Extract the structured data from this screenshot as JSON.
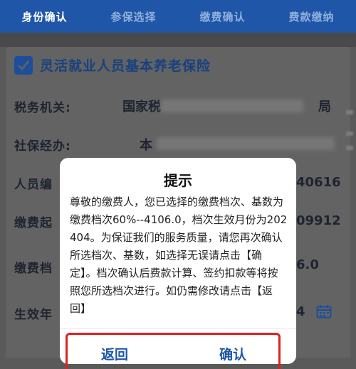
{
  "tabs": [
    "身份确认",
    "参保选择",
    "缴费确认",
    "费款缴纳"
  ],
  "insurance": {
    "title": "灵活就业人员基本养老保险",
    "checked": true
  },
  "form": {
    "tax_office_label": "税务机关:",
    "tax_office_value_start": "国家税",
    "tax_office_value_end": "局",
    "social_agency_label": "社保经办:",
    "social_agency_value_start": "本",
    "person_label_partial": "人员编",
    "person_value_end": "40616",
    "pay_start_label_partial": "缴费起",
    "pay_start_value_end": "09912",
    "pay_level_label_partial": "缴费档",
    "pay_level_value_end": "6.0",
    "effective_label_partial": "生效年",
    "effective_value_end": "4"
  },
  "dialog": {
    "title": "提示",
    "body": "尊敬的缴费人，您已选择的缴费档次、基数为缴费档次60%--4106.0，档次生效月份为202404。为保证我们的服务质量，请您再次确认所选档次、基数，如选择无误请点击【确定】。档次确认后费款计算、签约扣款等将按照您所选档次进行。如仍需修改请点击【返回】",
    "back_label": "返回",
    "confirm_label": "确认"
  },
  "colors": {
    "tab_bar": "#1f56a8",
    "accent": "#1f56a8",
    "highlight_frame": "#e02020"
  }
}
